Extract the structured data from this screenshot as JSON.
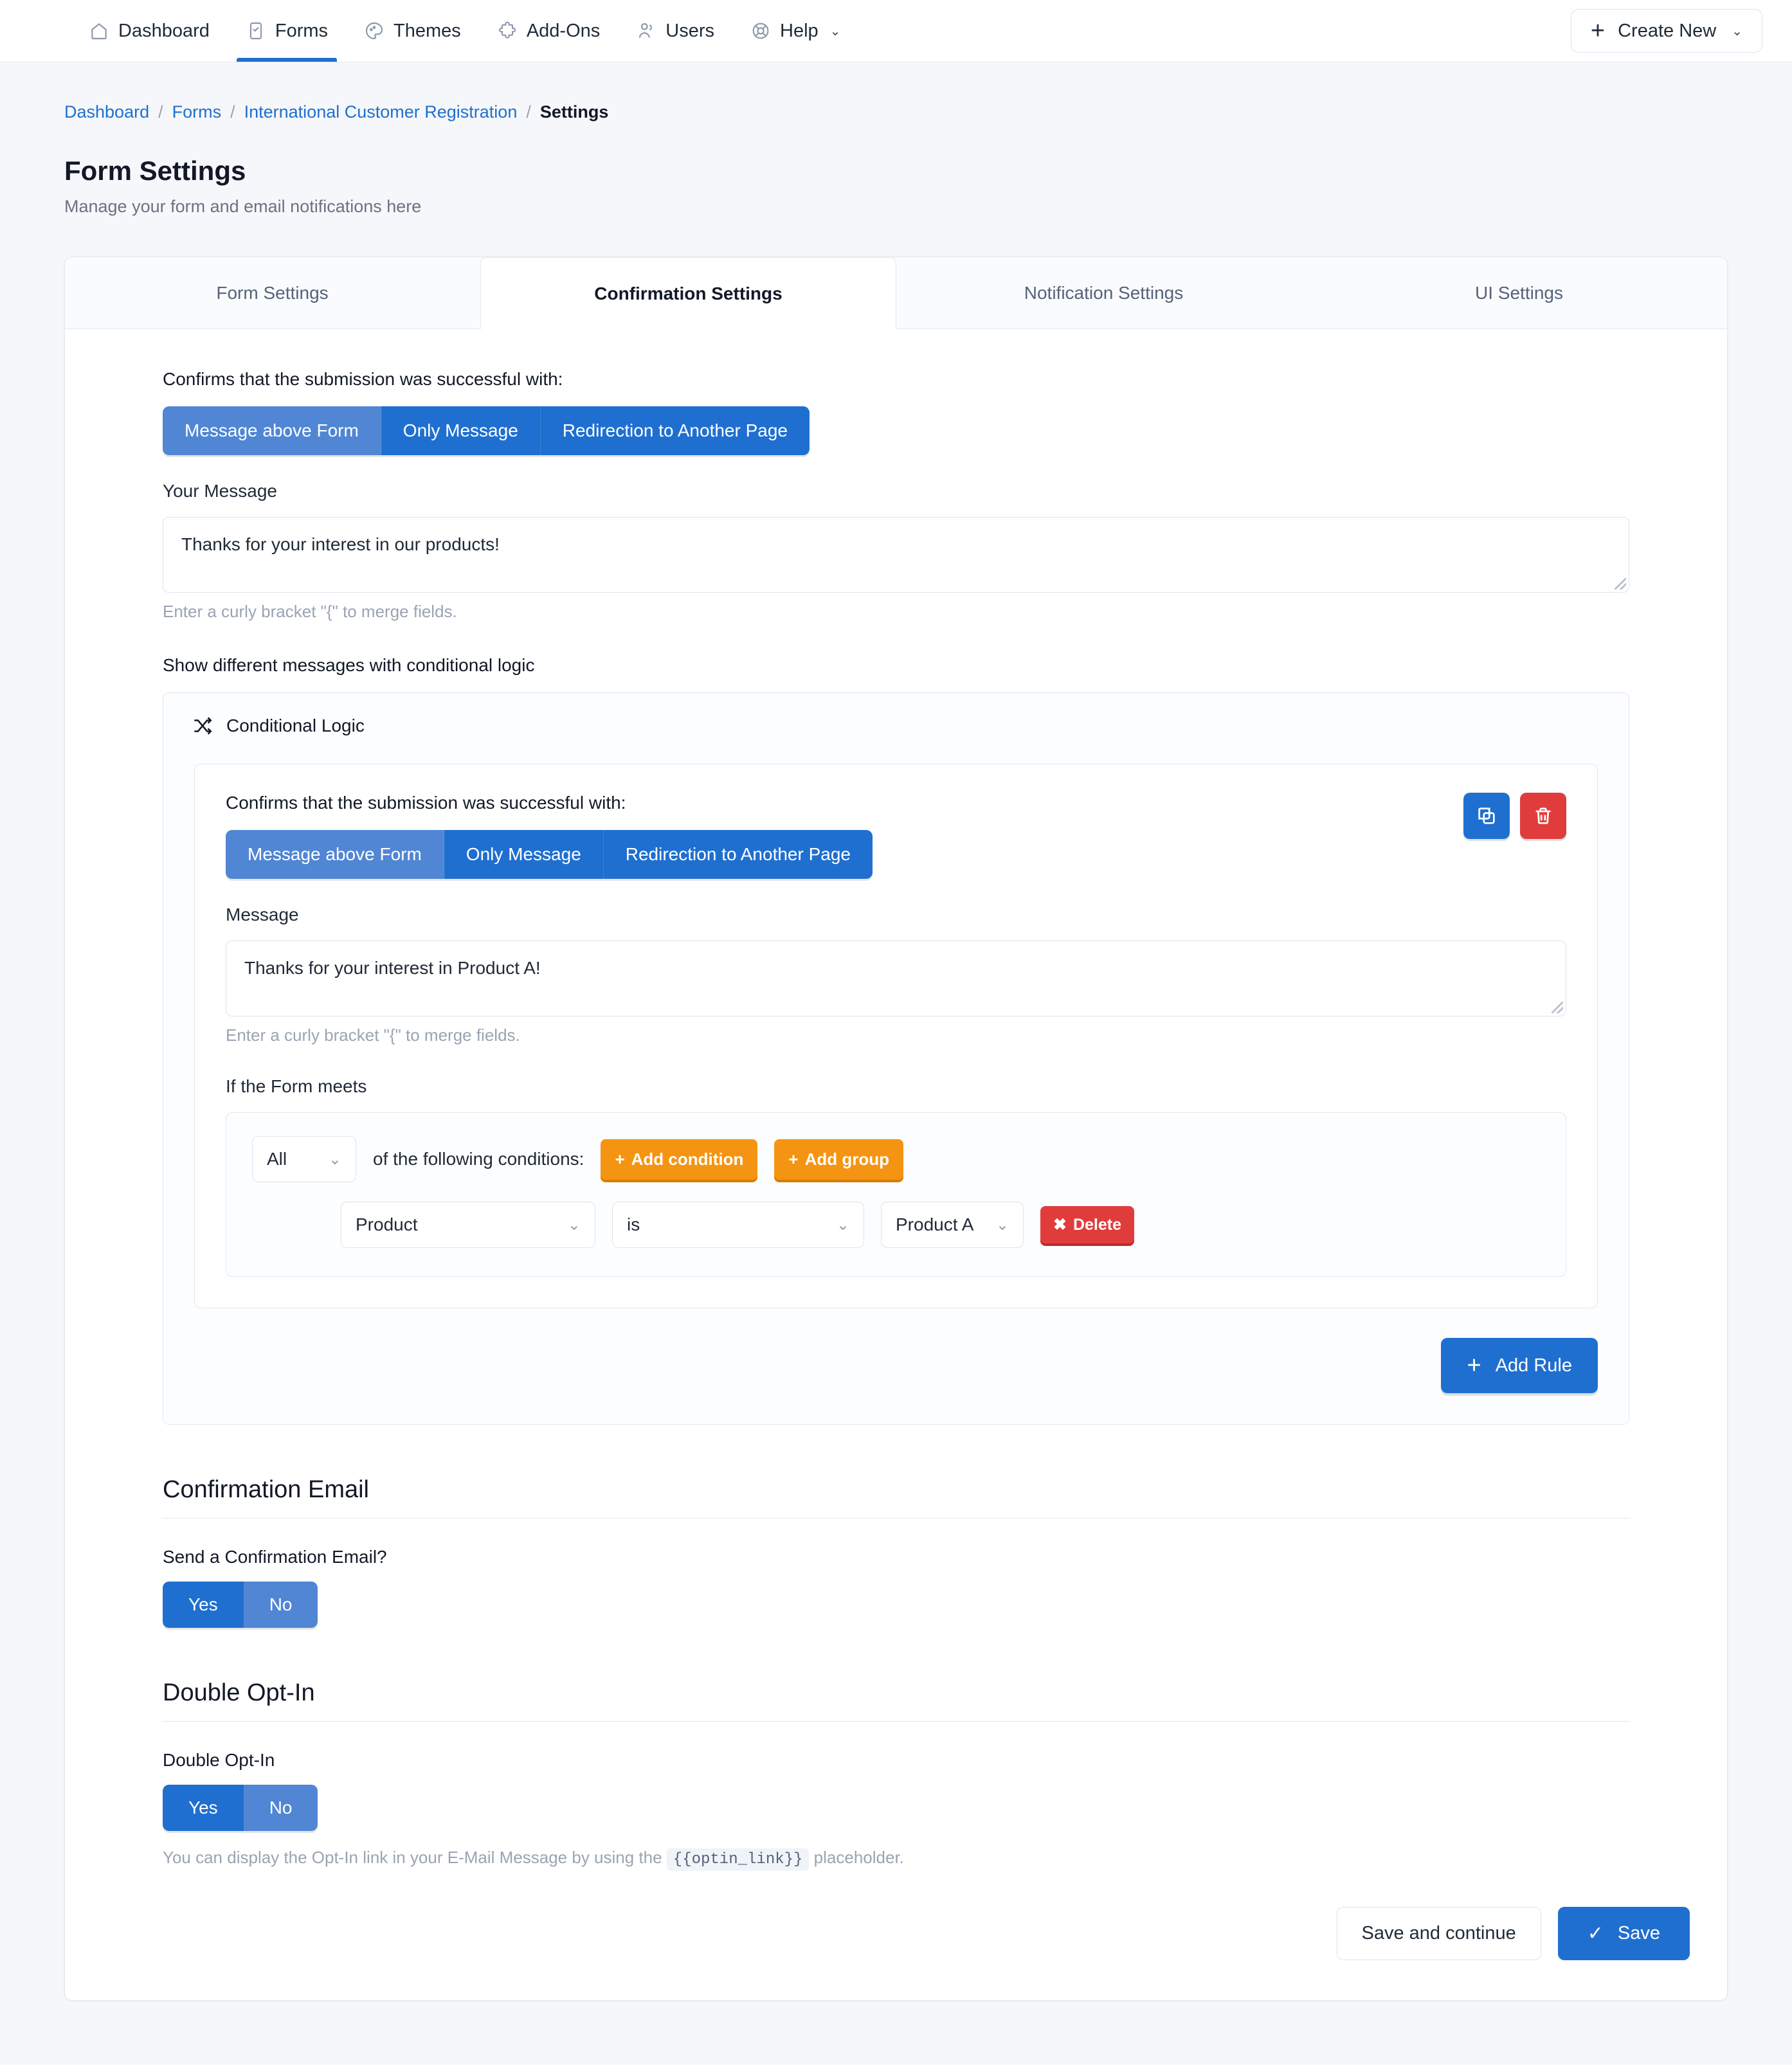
{
  "nav": {
    "items": [
      {
        "label": "Dashboard",
        "icon": "home-icon",
        "active": false
      },
      {
        "label": "Forms",
        "icon": "form-check-icon",
        "active": true
      },
      {
        "label": "Themes",
        "icon": "palette-icon",
        "active": false
      },
      {
        "label": "Add-Ons",
        "icon": "puzzle-icon",
        "active": false
      },
      {
        "label": "Users",
        "icon": "users-icon",
        "active": false
      },
      {
        "label": "Help",
        "icon": "lifebuoy-icon",
        "active": false,
        "caret": "⌄"
      }
    ],
    "create_new": {
      "label": "Create New",
      "plus": "+",
      "caret": "⌄"
    }
  },
  "breadcrumb": {
    "dashboard": "Dashboard",
    "forms": "Forms",
    "form_name": "International Customer Registration",
    "current": "Settings",
    "separator": "/"
  },
  "header": {
    "title": "Form Settings",
    "subtitle": "Manage your form and email notifications here"
  },
  "tabs": [
    {
      "label": "Form Settings",
      "active": false
    },
    {
      "label": "Confirmation Settings",
      "active": true
    },
    {
      "label": "Notification Settings",
      "active": false
    },
    {
      "label": "UI Settings",
      "active": false
    }
  ],
  "confirmation": {
    "confirms_label": "Confirms that the submission was successful with:",
    "modes": [
      {
        "label": "Message above Form",
        "selected": true
      },
      {
        "label": "Only Message",
        "selected": false
      },
      {
        "label": "Redirection to Another Page",
        "selected": false
      }
    ],
    "message_label": "Your Message",
    "message_value": "Thanks for your interest in our products!",
    "merge_hint": "Enter a curly bracket \"{\" to merge fields.",
    "conditional_heading": "Show different messages with conditional logic"
  },
  "conditional_logic": {
    "panel_title": "Conditional Logic",
    "panel_icon": "shuffle-icon",
    "rule": {
      "confirms_label": "Confirms that the submission was successful with:",
      "modes": [
        {
          "label": "Message above Form",
          "selected": true
        },
        {
          "label": "Only Message",
          "selected": false
        },
        {
          "label": "Redirection to Another Page",
          "selected": false
        }
      ],
      "copy_icon": "copy-icon",
      "delete_icon": "trash-icon",
      "message_label": "Message",
      "message_value": "Thanks for your interest in Product A!",
      "merge_hint": "Enter a curly bracket \"{\" to merge fields.",
      "conditions_label": "If the Form meets",
      "match_select": "All",
      "conditions_suffix": "of the following conditions:",
      "add_condition": "Add condition",
      "add_group": "Add group",
      "add_plus": "+",
      "condition": {
        "field": "Product",
        "operator": "is",
        "value": "Product A",
        "delete_label": "Delete",
        "delete_x": "✖"
      }
    },
    "add_rule": "Add Rule",
    "add_rule_plus": "+"
  },
  "confirmation_email": {
    "section_title": "Confirmation Email",
    "question": "Send a Confirmation Email?",
    "yes": "Yes",
    "no": "No",
    "selected": "Yes"
  },
  "double_optin": {
    "section_title": "Double Opt-In",
    "label": "Double Opt-In",
    "yes": "Yes",
    "no": "No",
    "selected": "Yes",
    "hint_before": "You can display the Opt-In link in your E-Mail Message by using the",
    "hint_code": "{{optin_link}}",
    "hint_after": "placeholder."
  },
  "footer": {
    "save_and_continue": "Save and continue",
    "save": "Save",
    "save_check": "✓"
  },
  "colors": {
    "primary_blue": "#1f6fd0",
    "light_blue": "#5086d4",
    "orange": "#f59412",
    "red": "#e13c3c",
    "page_bg": "#f5f7fa"
  }
}
